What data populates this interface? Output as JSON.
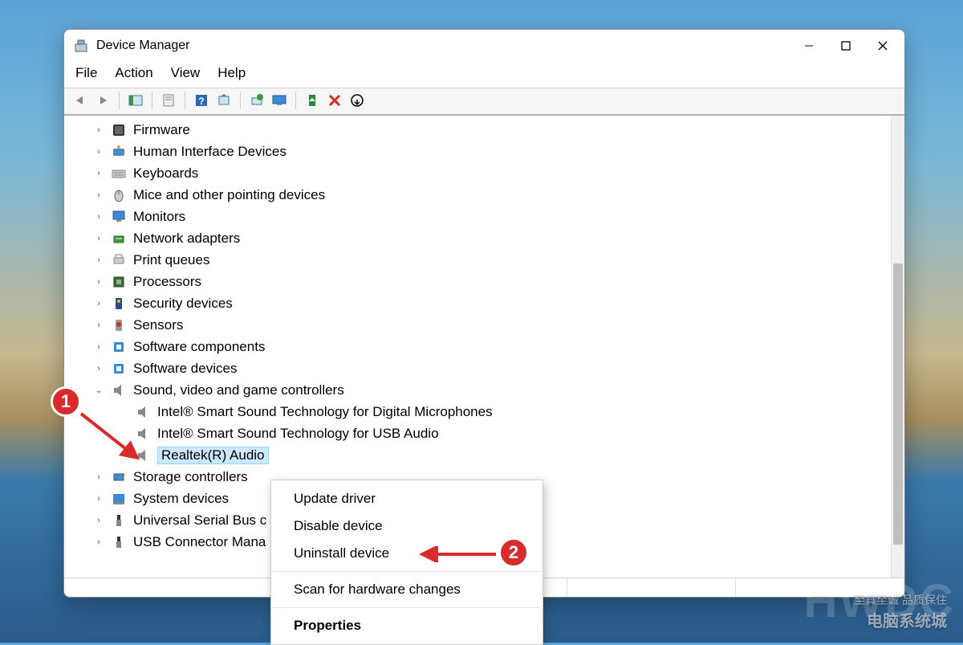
{
  "window": {
    "title": "Device Manager"
  },
  "menubar": [
    "File",
    "Action",
    "View",
    "Help"
  ],
  "tree": {
    "items": [
      {
        "label": "Firmware",
        "expanded": false,
        "icon": "firmware"
      },
      {
        "label": "Human Interface Devices",
        "expanded": false,
        "icon": "hid"
      },
      {
        "label": "Keyboards",
        "expanded": false,
        "icon": "keyboard"
      },
      {
        "label": "Mice and other pointing devices",
        "expanded": false,
        "icon": "mouse"
      },
      {
        "label": "Monitors",
        "expanded": false,
        "icon": "monitor"
      },
      {
        "label": "Network adapters",
        "expanded": false,
        "icon": "network"
      },
      {
        "label": "Print queues",
        "expanded": false,
        "icon": "printer"
      },
      {
        "label": "Processors",
        "expanded": false,
        "icon": "cpu"
      },
      {
        "label": "Security devices",
        "expanded": false,
        "icon": "security"
      },
      {
        "label": "Sensors",
        "expanded": false,
        "icon": "sensor"
      },
      {
        "label": "Software components",
        "expanded": false,
        "icon": "component"
      },
      {
        "label": "Software devices",
        "expanded": false,
        "icon": "component"
      },
      {
        "label": "Sound, video and game controllers",
        "expanded": true,
        "icon": "speaker",
        "children": [
          {
            "label": "Intel® Smart Sound Technology for Digital Microphones",
            "icon": "speaker"
          },
          {
            "label": "Intel® Smart Sound Technology for USB Audio",
            "icon": "speaker"
          },
          {
            "label": "Realtek(R) Audio",
            "icon": "speaker",
            "selected": true
          }
        ]
      },
      {
        "label": "Storage controllers",
        "expanded": false,
        "icon": "storage"
      },
      {
        "label": "System devices",
        "expanded": false,
        "icon": "system"
      },
      {
        "label": "Universal Serial Bus c",
        "expanded": false,
        "icon": "usb"
      },
      {
        "label": "USB Connector Mana",
        "expanded": false,
        "icon": "usb"
      }
    ]
  },
  "context_menu": {
    "items": [
      {
        "label": "Update driver"
      },
      {
        "label": "Disable device"
      },
      {
        "label": "Uninstall device"
      },
      {
        "divider": true
      },
      {
        "label": "Scan for hardware changes"
      },
      {
        "divider": true
      },
      {
        "label": "Properties",
        "bold": true
      }
    ]
  },
  "annotations": {
    "marker1": "1",
    "marker2": "2"
  },
  "watermark": {
    "line1": "至真至诚 品质保住",
    "line2": "电脑系统城",
    "big": "HWDC"
  }
}
